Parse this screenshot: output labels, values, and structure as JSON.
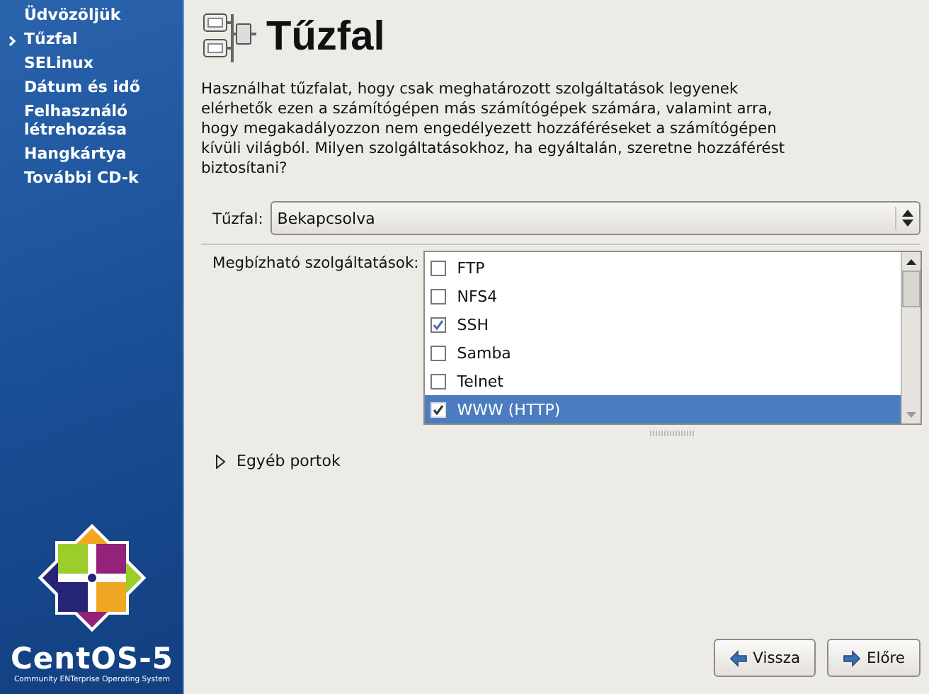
{
  "sidebar": {
    "items": [
      {
        "label": "Üdvözöljük",
        "selected": false
      },
      {
        "label": "Tűzfal",
        "selected": true
      },
      {
        "label": "SELinux",
        "selected": false
      },
      {
        "label": "Dátum és idő",
        "selected": false
      },
      {
        "label": "Felhasználó\nlétrehozása",
        "selected": false
      },
      {
        "label": "Hangkártya",
        "selected": false
      },
      {
        "label": "További CD-k",
        "selected": false
      }
    ],
    "logo": {
      "name": "CentOS-5",
      "tagline": "Community ENTerprise Operating System"
    }
  },
  "page": {
    "title": "Tűzfal",
    "description": "Használhat tűzfalat, hogy csak meghatározott szolgáltatások legyenek elérhetők ezen a számítógépen más számítógépek számára, valamint arra, hogy megakadályozzon nem engedélyezett hozzáféréseket a számítógépen kívüli világból. Milyen szolgáltatásokhoz, ha egyáltalán, szeretne hozzáférést biztosítani?",
    "firewall": {
      "label": "Tűzfal:",
      "value": "Bekapcsolva"
    },
    "services": {
      "label": "Megbízható szolgáltatások:",
      "items": [
        {
          "label": "FTP",
          "checked": false,
          "selected": false
        },
        {
          "label": "NFS4",
          "checked": false,
          "selected": false
        },
        {
          "label": "SSH",
          "checked": true,
          "selected": false
        },
        {
          "label": "Samba",
          "checked": false,
          "selected": false
        },
        {
          "label": "Telnet",
          "checked": false,
          "selected": false
        },
        {
          "label": "WWW (HTTP)",
          "checked": true,
          "selected": true
        }
      ]
    },
    "other_ports": {
      "label": "Egyéb portok",
      "expanded": false
    }
  },
  "buttons": [
    {
      "kind": "back",
      "label": "Vissza"
    },
    {
      "kind": "forward",
      "label": "Előre"
    }
  ]
}
